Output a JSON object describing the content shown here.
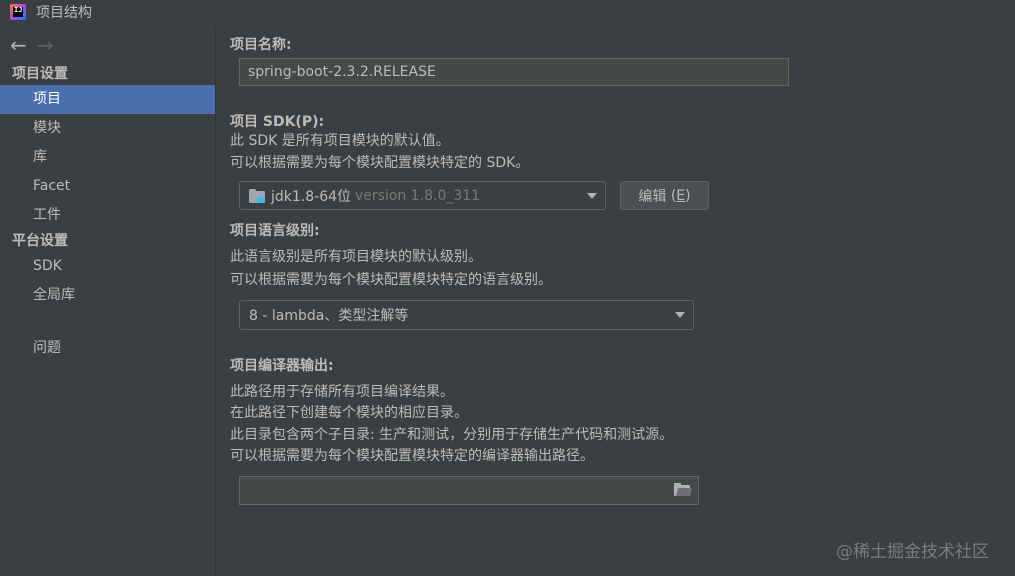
{
  "window": {
    "title": "项目结构"
  },
  "sidebar": {
    "sections": [
      {
        "header": "项目设置",
        "items": [
          "项目",
          "模块",
          "库",
          "Facet",
          "工件"
        ]
      },
      {
        "header": "平台设置",
        "items": [
          "SDK",
          "全局库"
        ]
      }
    ],
    "problems": "问题",
    "selected": "项目"
  },
  "main": {
    "project_name": {
      "label": "项目名称:",
      "value": "spring-boot-2.3.2.RELEASE"
    },
    "sdk": {
      "label": "项目 SDK(P):",
      "desc1": "此 SDK 是所有项目模块的默认值。",
      "desc2": "可以根据需要为每个模块配置模块特定的 SDK。",
      "selected": "jdk1.8-64位",
      "version": "version 1.8.0_311",
      "edit_label": "编辑",
      "edit_mnemonic": "E"
    },
    "language_level": {
      "label": "项目语言级别:",
      "desc1": "此语言级别是所有项目模块的默认级别。",
      "desc2": "可以根据需要为每个模块配置模块特定的语言级别。",
      "selected": "8 - lambda、类型注解等"
    },
    "compiler_output": {
      "label": "项目编译器输出:",
      "desc1": "此路径用于存储所有项目编译结果。",
      "desc2": "在此路径下创建每个模块的相应目录。",
      "desc3": "此目录包含两个子目录: 生产和测试，分别用于存储生产代码和测试源。",
      "desc4": "可以根据需要为每个模块配置模块特定的编译器输出路径。",
      "value": ""
    }
  },
  "watermark": "@稀土掘金技术社区",
  "colors": {
    "selection": "#4b6eaf",
    "background": "#3c3f41"
  },
  "icons": [
    "app-logo-icon",
    "back-arrow-icon",
    "forward-arrow-icon",
    "sdk-folder-icon",
    "chevron-down-icon",
    "browse-folder-icon"
  ]
}
